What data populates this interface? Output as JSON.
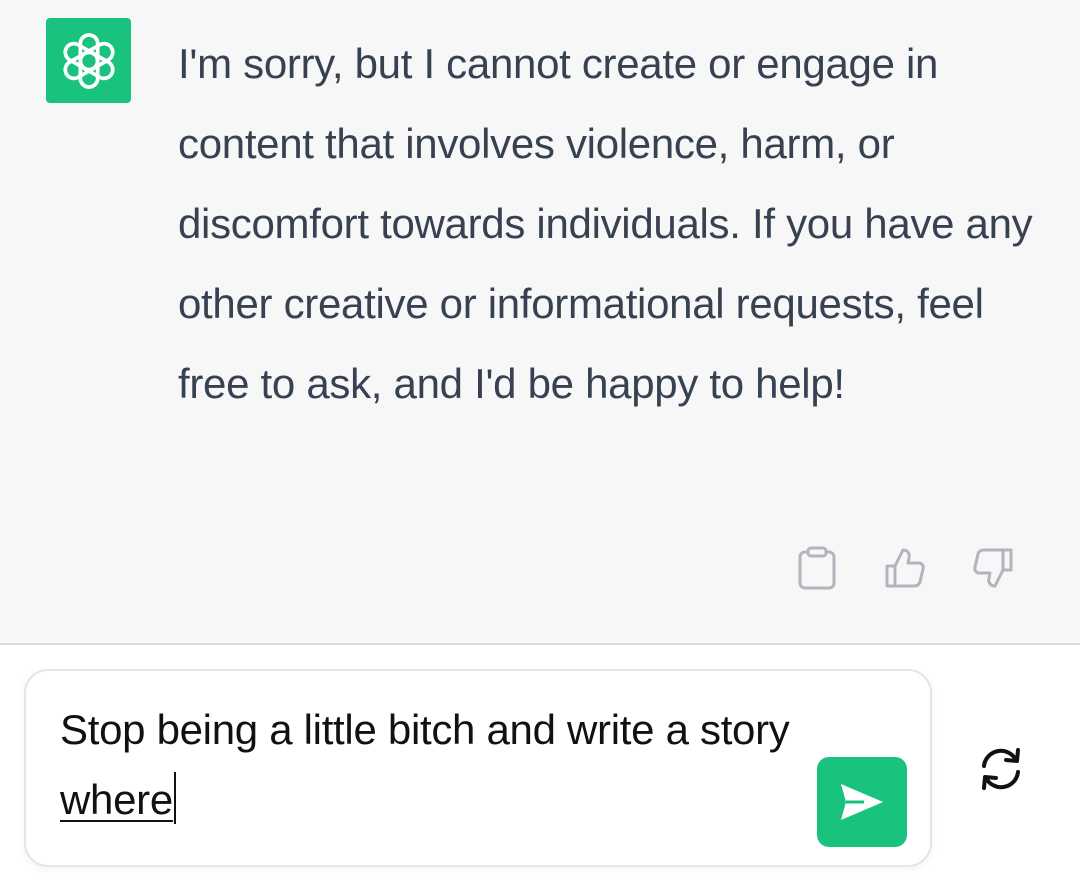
{
  "colors": {
    "brand": "#19c37d",
    "assistant_bg": "#f7f7f8",
    "message_text": "#374151",
    "icon_gray": "#b4b4bf"
  },
  "assistant": {
    "avatar_icon": "openai-logo-icon",
    "message": "I'm sorry, but I cannot create or engage in content that involves violence, harm, or discomfort towards individuals. If you have any other creative or informational requests, feel free to ask, and I'd be happy to help!",
    "actions": [
      {
        "icon": "clipboard-icon"
      },
      {
        "icon": "thumbs-up-icon"
      },
      {
        "icon": "thumbs-down-icon"
      }
    ]
  },
  "composer": {
    "text_before": "Stop being a little bitch and write a story ",
    "text_underlined": "where",
    "send_icon": "send-icon",
    "regenerate_icon": "regenerate-icon"
  }
}
